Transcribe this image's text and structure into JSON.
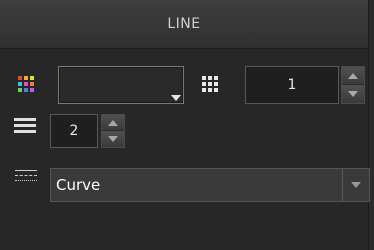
{
  "panel": {
    "title": "LINE"
  },
  "color_row": {
    "color_icon": "color-grid-icon",
    "swatch_color": "#2a2a2a",
    "density_icon": "dot-grid-icon",
    "density_value": "1"
  },
  "width_row": {
    "icon": "line-weight-icon",
    "value": "2"
  },
  "style_row": {
    "icon": "line-style-icon",
    "selected": "Curve"
  },
  "colors": {
    "icon_grid": [
      "#e04848",
      "#f0b030",
      "#e0e040",
      "#40c0e0",
      "#e050d0",
      "#f08030",
      "#70d050",
      "#5080e0",
      "#c060e0"
    ]
  }
}
